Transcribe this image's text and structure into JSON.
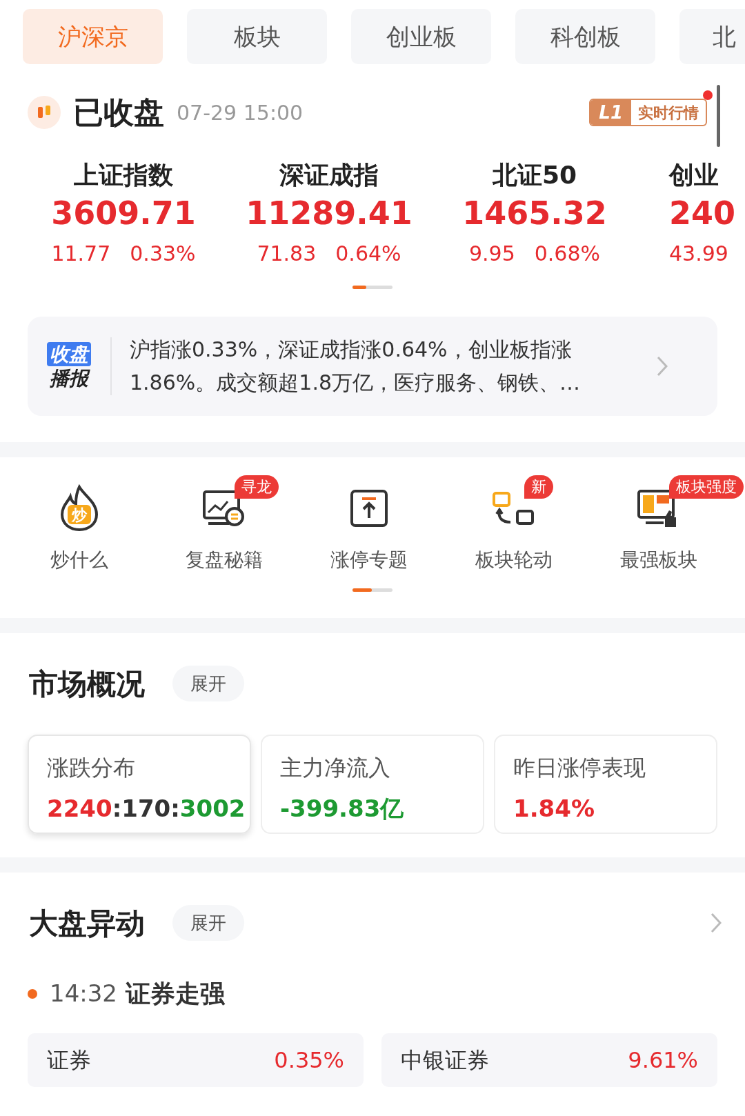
{
  "tabs": [
    {
      "label": "沪深京",
      "selected": true
    },
    {
      "label": "板块",
      "selected": false
    },
    {
      "label": "创业板",
      "selected": false
    },
    {
      "label": "科创板",
      "selected": false
    },
    {
      "label": "北",
      "selected": false
    }
  ],
  "status": {
    "title": "已收盘",
    "time": "07-29 15:00",
    "badge_level": "L1",
    "badge_text": "实时行情",
    "notice_dot": true
  },
  "indices": [
    {
      "name": "上证指数",
      "value": "3609.71",
      "change": "11.77",
      "percent": "0.33%"
    },
    {
      "name": "深证成指",
      "value": "11289.41",
      "change": "71.83",
      "percent": "0.64%"
    },
    {
      "name": "北证50",
      "value": "1465.32",
      "change": "9.95",
      "percent": "0.68%"
    },
    {
      "name": "创业",
      "value": "240",
      "change": "43.99"
    }
  ],
  "broadcast": {
    "tag_top": "收盘",
    "tag_bottom": "播报",
    "text": "沪指涨0.33%，深证成指涨0.64%，创业板指涨1.86%。成交额超1.8万亿，医疗服务、钢铁、…"
  },
  "shortcuts": [
    {
      "kind": "fire",
      "label": "炒什么",
      "icon_text": "炒"
    },
    {
      "kind": "review",
      "label": "复盘秘籍",
      "badge": "寻龙"
    },
    {
      "kind": "limit",
      "label": "涨停专题"
    },
    {
      "kind": "rotate",
      "label": "板块轮动",
      "badge": "新"
    },
    {
      "kind": "strong",
      "label": "最强板块",
      "badge": "板块强度"
    }
  ],
  "market": {
    "title": "市场概况",
    "toggle": "展开",
    "cards": [
      {
        "title": "涨跌分布",
        "selected": true,
        "parts": [
          {
            "text": "2240",
            "kind": "up"
          },
          {
            "text": ":170:",
            "kind": "flat"
          },
          {
            "text": "3002",
            "kind": "down"
          }
        ]
      },
      {
        "title": "主力净流入",
        "selected": false,
        "parts": [
          {
            "text": "-399.83亿",
            "kind": "down"
          }
        ]
      },
      {
        "title": "昨日涨停表现",
        "selected": false,
        "parts": [
          {
            "text": "1.84%",
            "kind": "up"
          }
        ]
      }
    ]
  },
  "moves": {
    "title": "大盘异动",
    "toggle": "展开",
    "event_time": "14:32",
    "event_text": "证券走强",
    "items": [
      {
        "name": "证券",
        "percent": "0.35%"
      },
      {
        "name": "中银证券",
        "percent": "9.61%"
      }
    ]
  }
}
